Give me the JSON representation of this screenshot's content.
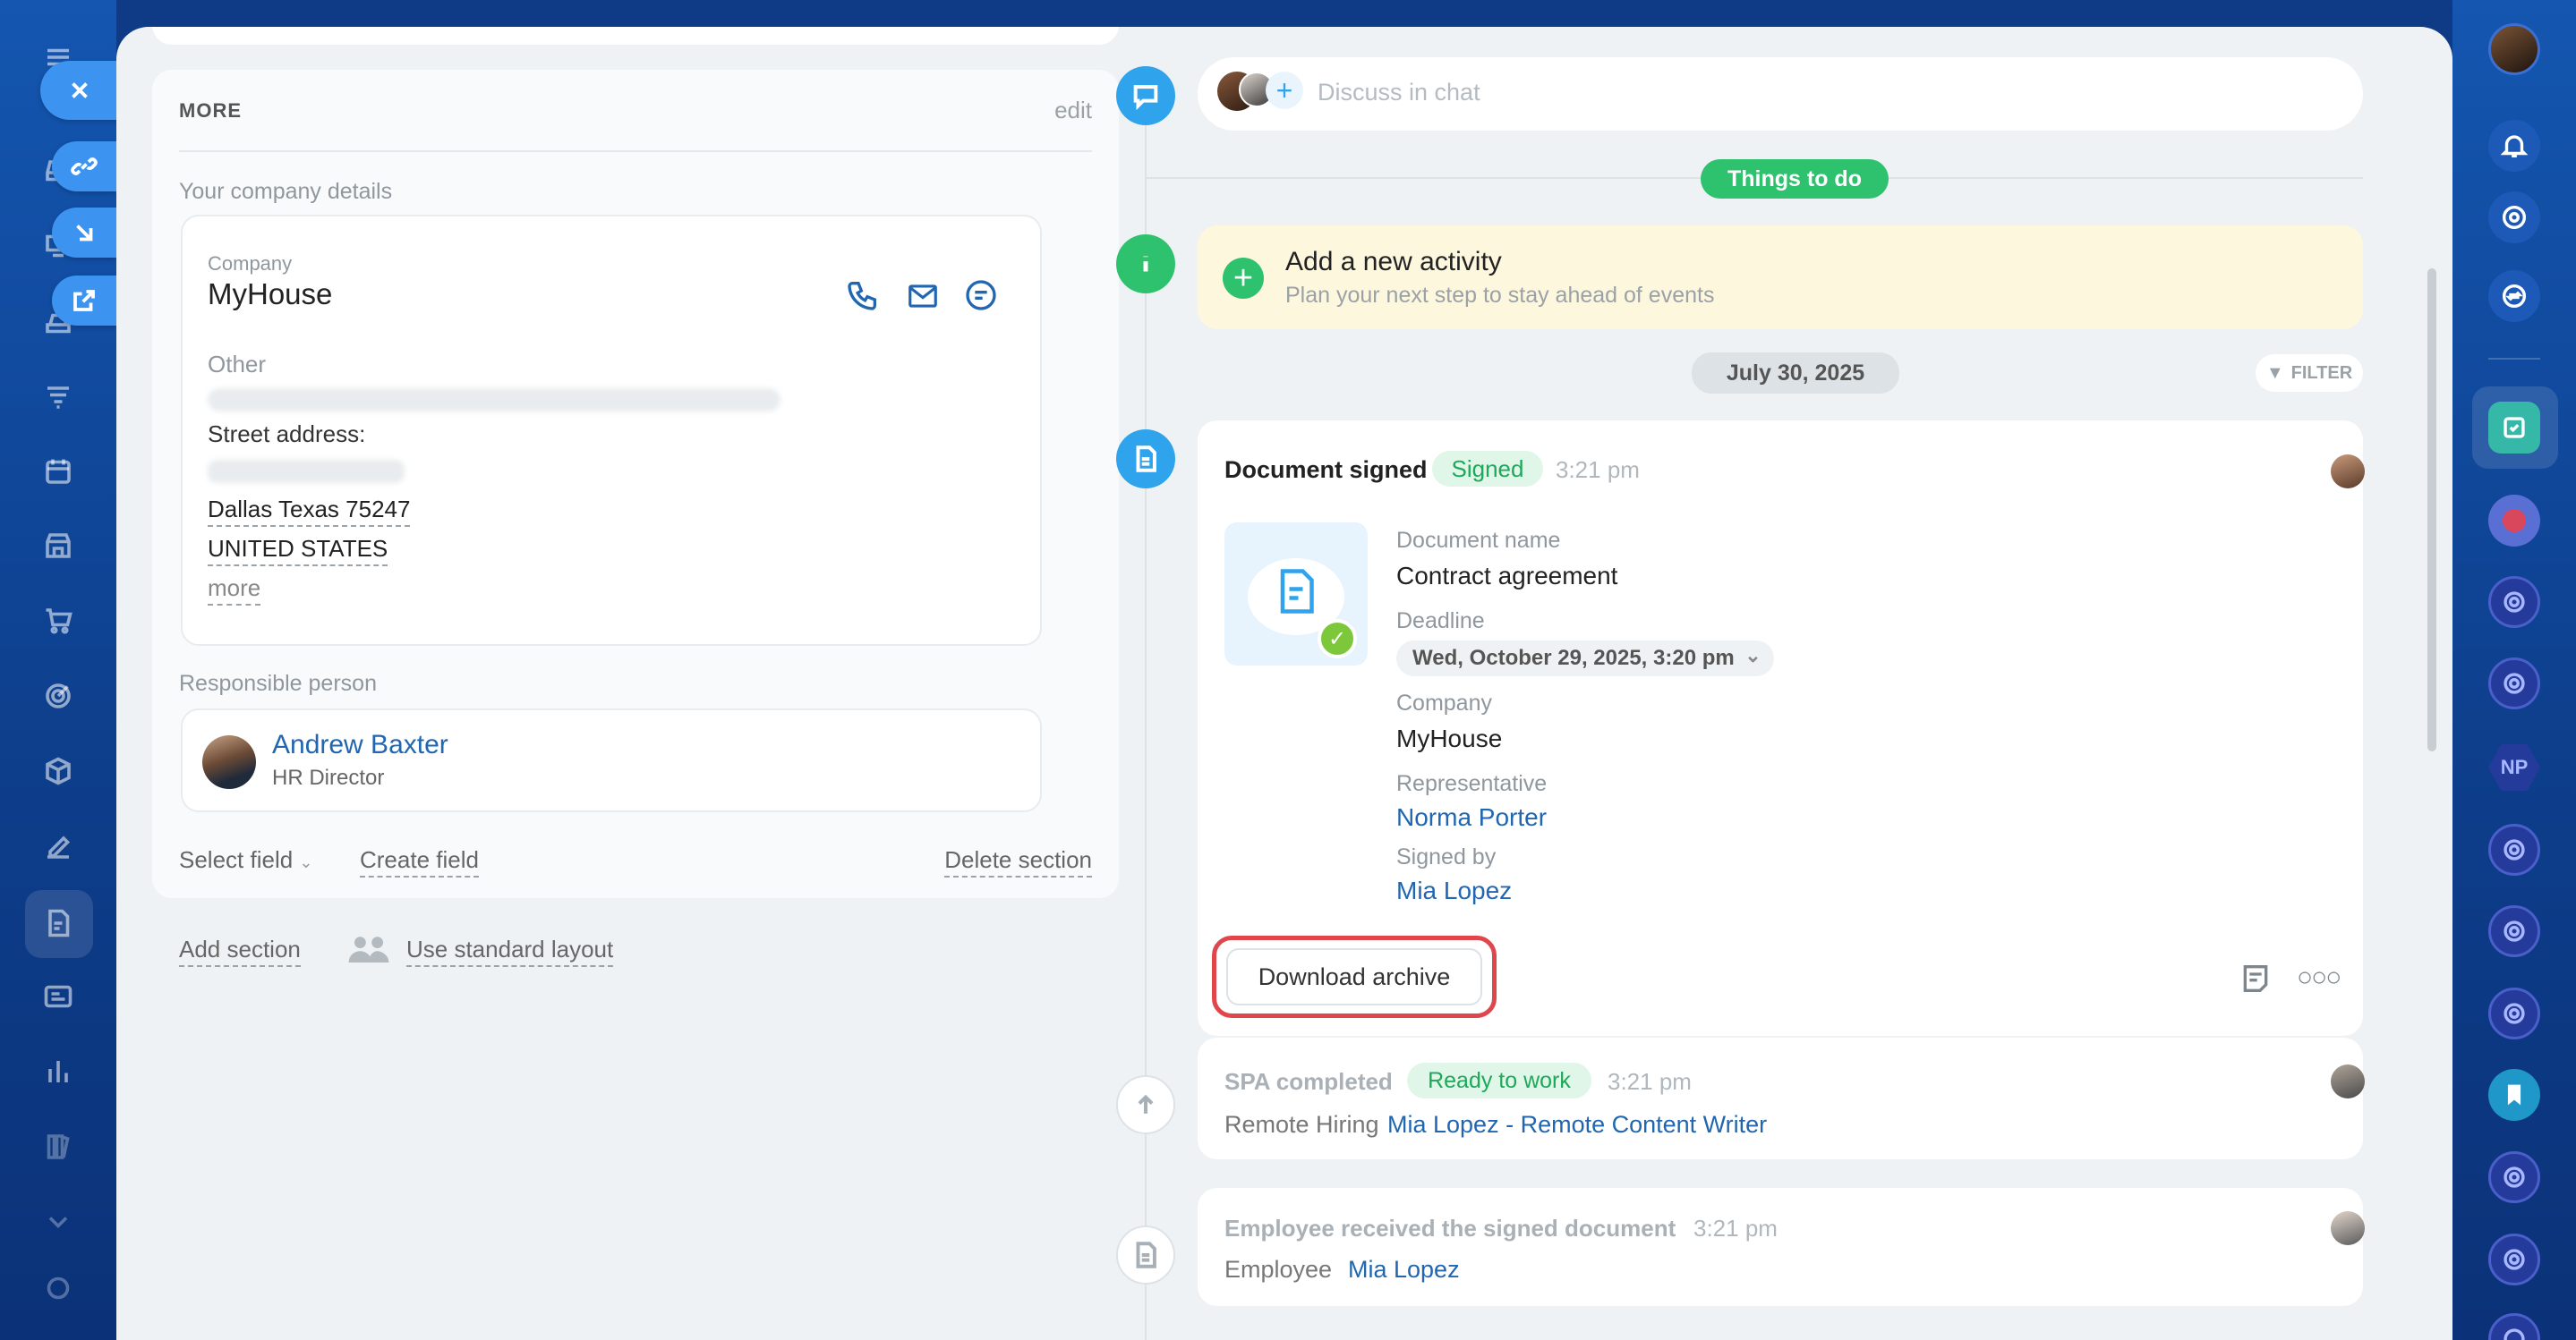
{
  "more_card": {
    "title": "MORE",
    "edit_label": "edit",
    "company_details_label": "Your company details",
    "company": {
      "label": "Company",
      "name": "MyHouse",
      "other_label": "Other",
      "street_label": "Street address:",
      "city_line": "Dallas Texas 75247",
      "country_line": "UNITED STATES",
      "more_label": "more"
    },
    "responsible": {
      "label": "Responsible person",
      "name": "Andrew Baxter",
      "role": "HR Director"
    },
    "select_field_label": "Select field",
    "create_field_label": "Create field",
    "delete_section_label": "Delete section"
  },
  "below_card": {
    "add_section_label": "Add section",
    "standard_layout_label": "Use standard layout"
  },
  "timeline": {
    "chat_placeholder": "Discuss in chat",
    "things_to_do": "Things to do",
    "activity": {
      "title": "Add a new activity",
      "subtitle": "Plan your next step to stay ahead of events"
    },
    "date_badge": "July 30, 2025",
    "filter_label": "FILTER",
    "doc_signed": {
      "title": "Document signed",
      "status": "Signed",
      "time": "3:21 pm",
      "doc_name_label": "Document name",
      "doc_name": "Contract agreement",
      "deadline_label": "Deadline",
      "deadline_value": "Wed, October 29, 2025, 3:20 pm",
      "company_label": "Company",
      "company_value": "MyHouse",
      "rep_label": "Representative",
      "rep_value": "Norma Porter",
      "signed_by_label": "Signed by",
      "signed_by_value": "Mia Lopez",
      "download_button": "Download archive"
    },
    "spa": {
      "title": "SPA completed",
      "status": "Ready to work",
      "time": "3:21 pm",
      "prefix": "Remote Hiring",
      "link": "Mia Lopez - Remote Content Writer"
    },
    "employee_doc": {
      "title": "Employee received the signed document",
      "time": "3:21 pm",
      "prefix": "Employee",
      "link": "Mia Lopez"
    }
  },
  "right_bar": {
    "np_label": "NP"
  },
  "colors": {
    "accent_blue": "#2066b0",
    "green_badge": "#2fc26e",
    "highlight_red": "#e0474c",
    "activity_bg": "#fdf7de"
  }
}
